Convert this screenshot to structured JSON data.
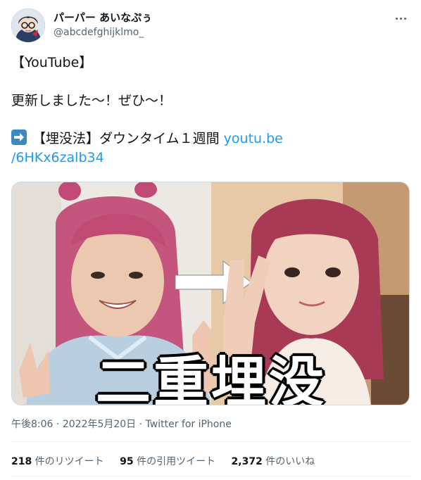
{
  "user": {
    "display_name": "パーパー あいなぷぅ",
    "handle": "@abcdefghijklmo_",
    "avatar_icon": "user-avatar"
  },
  "tweet": {
    "lines": [
      "【YouTube】",
      "更新しました〜！ぜひ〜！"
    ],
    "link_line_text": "【埋没法】ダウンタイム１週間 ",
    "link_part1": "youtu.be",
    "link_part2": "/6HKx6zalb34",
    "arrow_emoji": "arrow-right-emoji"
  },
  "media": {
    "caption": "二重埋没"
  },
  "meta": {
    "time": "午後8:06",
    "sep1": " · ",
    "date": "2022年5月20日",
    "sep2": " · ",
    "source": "Twitter for iPhone"
  },
  "stats": {
    "retweets_count": "218",
    "retweets_label": " 件のリツイート",
    "quotes_count": "95",
    "quotes_label": " 件の引用ツイート",
    "likes_count": "2,372",
    "likes_label": " 件のいいね"
  },
  "colors": {
    "link": "#1d9bf0",
    "secondary_text": "#536471",
    "primary_text": "#0f1419"
  }
}
